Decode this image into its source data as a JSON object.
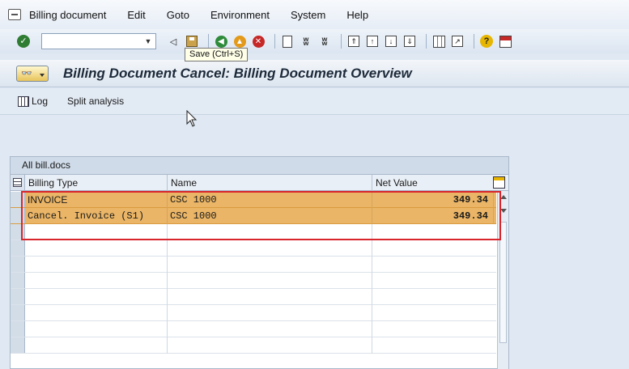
{
  "menu": {
    "items": [
      "Billing document",
      "Edit",
      "Goto",
      "Environment",
      "System",
      "Help"
    ]
  },
  "toolbar": {
    "command_value": "",
    "tooltip": "Save   (Ctrl+S)"
  },
  "title": {
    "text": "Billing Document Cancel: Billing Document Overview"
  },
  "app_toolbar": {
    "log_label": "Log",
    "split_label": "Split analysis"
  },
  "grid": {
    "caption": "All bill.docs",
    "columns": [
      "Billing Type",
      "Name",
      "Net Value"
    ],
    "rows": [
      {
        "billing_type": "INVOICE",
        "name": "CSC 1000",
        "net_value": "349.34"
      },
      {
        "billing_type": "Cancel. Invoice (S1)",
        "name": "CSC 1000",
        "net_value": "349.34"
      }
    ],
    "highlight_color": "#eab566",
    "annotation_color": "#d9262c"
  }
}
